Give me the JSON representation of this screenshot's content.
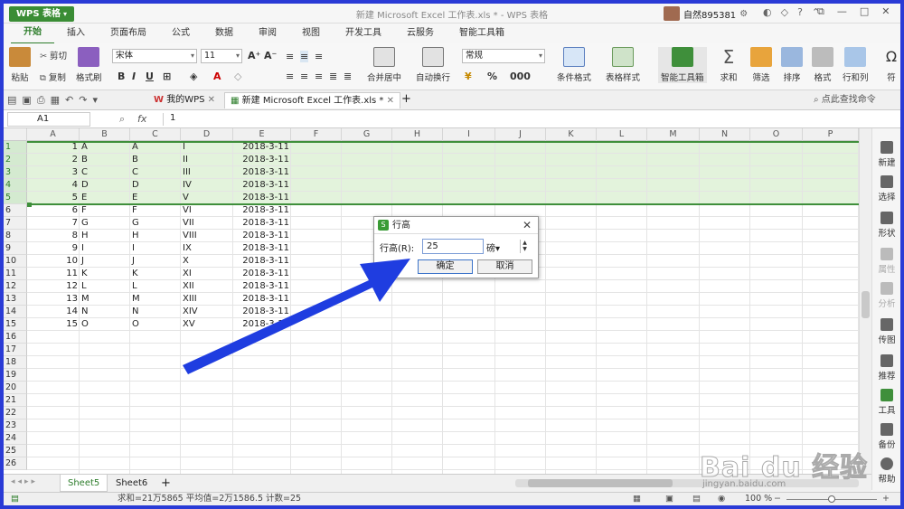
{
  "app": {
    "name": "WPS 表格",
    "window_title": "新建 Microsoft Excel 工作表.xls * - WPS 表格"
  },
  "user": {
    "name": "自然895381"
  },
  "tabs": [
    "开始",
    "插入",
    "页面布局",
    "公式",
    "数据",
    "审阅",
    "视图",
    "开发工具",
    "云服务",
    "智能工具箱"
  ],
  "active_tab": "开始",
  "ribbon": {
    "paste": "粘贴",
    "cut": "剪切",
    "copy": "复制",
    "format_painter": "格式刷",
    "font": "宋体",
    "font_size": "11",
    "bold": "B",
    "italic": "I",
    "underline": "U",
    "merge_center": "合并居中",
    "wrap_text": "自动换行",
    "number_format": "常规",
    "percent": "%",
    "comma": ",",
    "cond_format": "条件格式",
    "table_style": "表格样式",
    "smart_toolbox": "智能工具箱",
    "sum": "求和",
    "filter": "筛选",
    "sort": "排序",
    "format": "格式",
    "rows_cols": "行和列",
    "symbol": "符"
  },
  "doc_tabs": {
    "home": "我的WPS",
    "file": "新建 Microsoft Excel 工作表.xls *",
    "search": "点此查找命令"
  },
  "formula_bar": {
    "name_box": "A1",
    "fx": "fx",
    "value": "1"
  },
  "columns": [
    "A",
    "B",
    "C",
    "D",
    "E",
    "F",
    "G",
    "H",
    "I",
    "J",
    "K",
    "L",
    "M",
    "N",
    "O",
    "P"
  ],
  "rows": [
    [
      "1",
      "A",
      "A",
      "I",
      "2018-3-11"
    ],
    [
      "2",
      "B",
      "B",
      "II",
      "2018-3-11"
    ],
    [
      "3",
      "C",
      "C",
      "III",
      "2018-3-11"
    ],
    [
      "4",
      "D",
      "D",
      "IV",
      "2018-3-11"
    ],
    [
      "5",
      "E",
      "E",
      "V",
      "2018-3-11"
    ],
    [
      "6",
      "F",
      "F",
      "VI",
      "2018-3-11"
    ],
    [
      "7",
      "G",
      "G",
      "VII",
      "2018-3-11"
    ],
    [
      "8",
      "H",
      "H",
      "VIII",
      "2018-3-11"
    ],
    [
      "9",
      "I",
      "I",
      "IX",
      "2018-3-11"
    ],
    [
      "10",
      "J",
      "J",
      "X",
      "2018-3-11"
    ],
    [
      "11",
      "K",
      "K",
      "XI",
      "2018-3-11"
    ],
    [
      "12",
      "L",
      "L",
      "XII",
      "2018-3-11"
    ],
    [
      "13",
      "M",
      "M",
      "XIII",
      "2018-3-11"
    ],
    [
      "14",
      "N",
      "N",
      "XIV",
      "2018-3-11"
    ],
    [
      "15",
      "O",
      "O",
      "XV",
      "2018-3-11"
    ]
  ],
  "row_numbers": [
    "1",
    "2",
    "3",
    "4",
    "5",
    "6",
    "7",
    "8",
    "9",
    "10",
    "11",
    "12",
    "13",
    "14",
    "15",
    "16",
    "17",
    "18",
    "19",
    "20",
    "21",
    "22",
    "23",
    "24",
    "25",
    "26"
  ],
  "selected_rows": 5,
  "right_pane": [
    "新建",
    "选择",
    "形状",
    "属性",
    "分析",
    "传图",
    "推荐",
    "工具",
    "备份",
    "帮助"
  ],
  "sheets": [
    "Sheet5",
    "Sheet6"
  ],
  "active_sheet": "Sheet5",
  "status": {
    "text": "求和=21万5865  平均值=2万1586.5  计数=25",
    "zoom": "100 %"
  },
  "dialog": {
    "title": "行高",
    "label": "行高(R):",
    "value": "25",
    "unit": "磅",
    "ok": "确定",
    "cancel": "取消"
  },
  "watermark": {
    "brand": "Bai du 经验",
    "url": "jingyan.baidu.com"
  },
  "colors": {
    "accent": "#2d7d2b",
    "selection": "#e3f3dc",
    "arrow": "#1f3de0",
    "frame": "#2a3bd6"
  }
}
